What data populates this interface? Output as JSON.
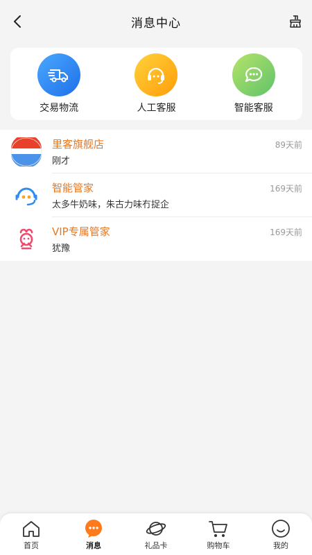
{
  "header": {
    "title": "消息中心"
  },
  "quick_actions": [
    {
      "label": "交易物流",
      "icon": "truck-icon"
    },
    {
      "label": "人工客服",
      "icon": "headset-icon"
    },
    {
      "label": "智能客服",
      "icon": "chat-bubble-icon"
    }
  ],
  "messages": [
    {
      "name": "里客旗舰店",
      "time": "89天前",
      "preview": "刚才",
      "avatar": "store-logo-icon"
    },
    {
      "name": "智能管家",
      "time": "169天前",
      "preview": "太多牛奶味，朱古力味冇捉企",
      "avatar": "robot-headset-icon"
    },
    {
      "name": "VIP专属管家",
      "time": "169天前",
      "preview": "犹豫",
      "avatar": "vip-mascot-icon"
    }
  ],
  "tabbar": [
    {
      "label": "首页",
      "icon": "home-icon"
    },
    {
      "label": "消息",
      "icon": "message-icon",
      "active": true
    },
    {
      "label": "礼品卡",
      "icon": "planet-icon"
    },
    {
      "label": "购物车",
      "icon": "cart-icon"
    },
    {
      "label": "我的",
      "icon": "smiley-icon"
    }
  ],
  "colors": {
    "accent": "#e87722",
    "logistics_gradient": [
      "#4aa8ff",
      "#1f6fe8"
    ],
    "agent_gradient": [
      "#ffd23a",
      "#ff9d0a"
    ],
    "bot_gradient": [
      "#b6e36a",
      "#5fc36a"
    ]
  }
}
